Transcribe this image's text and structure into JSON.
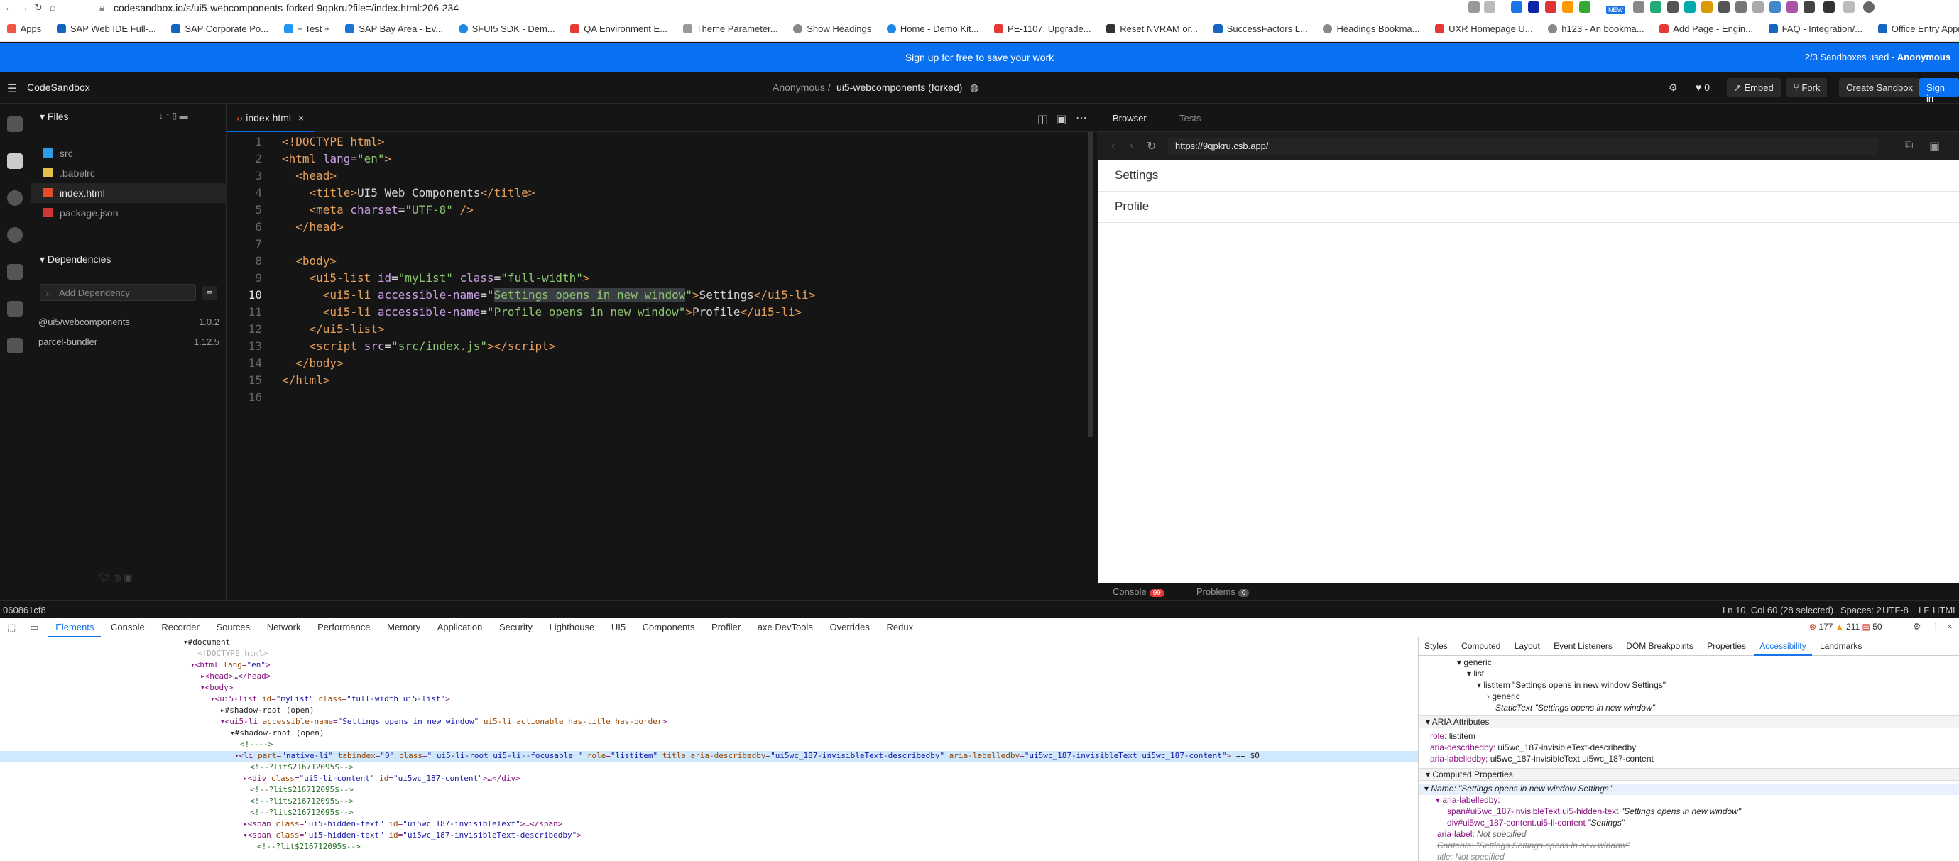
{
  "browser": {
    "url": "codesandbox.io/s/ui5-webcomponents-forked-9qpkru?file=/index.html:206-234",
    "bookmarks": [
      "Apps",
      "SAP Web IDE Full-...",
      "SAP Corporate Po...",
      "+ Test +",
      "SAP Bay Area - Ev...",
      "SFUI5 SDK - Dem...",
      "QA Environment E...",
      "Theme Parameter...",
      "Show Headings",
      "Home - Demo Kit...",
      "PE-1107. Upgrade...",
      "Reset NVRAM or...",
      "SuccessFactors L...",
      "Headings Bookma...",
      "UXR Homepage U...",
      "h123 - An bookma...",
      "Add Page - Engin...",
      "FAQ - Integration/...",
      "Office Entry Appr..."
    ],
    "new_badge": "NEW"
  },
  "banner": {
    "text": "Sign up for free to save your work",
    "count": "2/3 Sandboxes used -",
    "user": "Anonymous"
  },
  "header": {
    "logo": "CodeSandbox",
    "owner": "Anonymous /",
    "sandbox_name": "ui5-webcomponents (forked)",
    "likes": "0",
    "embed": "Embed",
    "fork": "Fork",
    "create": "Create Sandbox",
    "signin": "Sign in"
  },
  "sidebar": {
    "files_title": "Files",
    "files": [
      {
        "name": "src",
        "icon": "folder-icon"
      },
      {
        "name": ".babelrc",
        "icon": "babel-icon"
      },
      {
        "name": "index.html",
        "icon": "html-icon"
      },
      {
        "name": "package.json",
        "icon": "json-icon"
      }
    ],
    "dependencies_title": "Dependencies",
    "add_dependency_placeholder": "Add Dependency",
    "dependencies": [
      {
        "name": "@ui5/webcomponents",
        "version": "1.0.2"
      },
      {
        "name": "parcel-bundler",
        "version": "1.12.5"
      }
    ]
  },
  "editor": {
    "tab": "index.html",
    "lines": [
      "1",
      "2",
      "3",
      "4",
      "5",
      "6",
      "7",
      "8",
      "9",
      "10",
      "11",
      "12",
      "13",
      "14",
      "15",
      "16"
    ]
  },
  "preview": {
    "tabs": [
      "Browser",
      "Tests"
    ],
    "address": "https://9qpkru.csb.app/",
    "items": [
      "Settings",
      "Profile"
    ],
    "console": "Console",
    "console_count": "99",
    "problems": "Problems",
    "problems_count": "0"
  },
  "statusbar": {
    "left": "060861cf8",
    "position": "Ln 10, Col 60 (28 selected)",
    "spaces": "Spaces: 2",
    "encoding": "UTF-8",
    "eol": "LF",
    "lang": "HTML"
  },
  "devtools": {
    "tabs": [
      "Elements",
      "Console",
      "Recorder",
      "Sources",
      "Network",
      "Performance",
      "Memory",
      "Application",
      "Security",
      "Lighthouse",
      "UI5",
      "Components",
      "Profiler",
      "axe DevTools",
      "Overrides",
      "Redux"
    ],
    "errors": "177",
    "warnings": "211",
    "issues": "50",
    "side_tabs": [
      "Styles",
      "Computed",
      "Layout",
      "Event Listeners",
      "DOM Breakpoints",
      "Properties",
      "Accessibility",
      "Landmarks"
    ],
    "tree": {
      "generic1": "generic",
      "list": "list",
      "listitem": "listitem \"Settings opens in new window Settings\"",
      "generic2": "generic",
      "static": "StaticText \"Settings opens in new window\""
    },
    "aria_title": "ARIA Attributes",
    "aria": [
      {
        "k": "role:",
        "v": "listitem"
      },
      {
        "k": "aria-describedby:",
        "v": "ui5wc_187-invisibleText-describedby"
      },
      {
        "k": "aria-labelledby:",
        "v": "ui5wc_187-invisibleText ui5wc_187-content"
      }
    ],
    "computed_title": "Computed Properties",
    "name_line": "Name: \"Settings opens in new window Settings\"",
    "labelledby": "aria-labelledby:",
    "span_ref": "span#ui5wc_187-invisibleText.ui5-hidden-text",
    "span_val": "\"Settings opens in new window\"",
    "div_ref": "div#ui5wc_187-content.ui5-li-content",
    "div_val": "\"Settings\"",
    "aria_label": "aria-label:",
    "not_specified": "Not specified",
    "contents": "Contents: \"Settings Settings opens in new window\"",
    "title_line": "title: Not specified"
  }
}
